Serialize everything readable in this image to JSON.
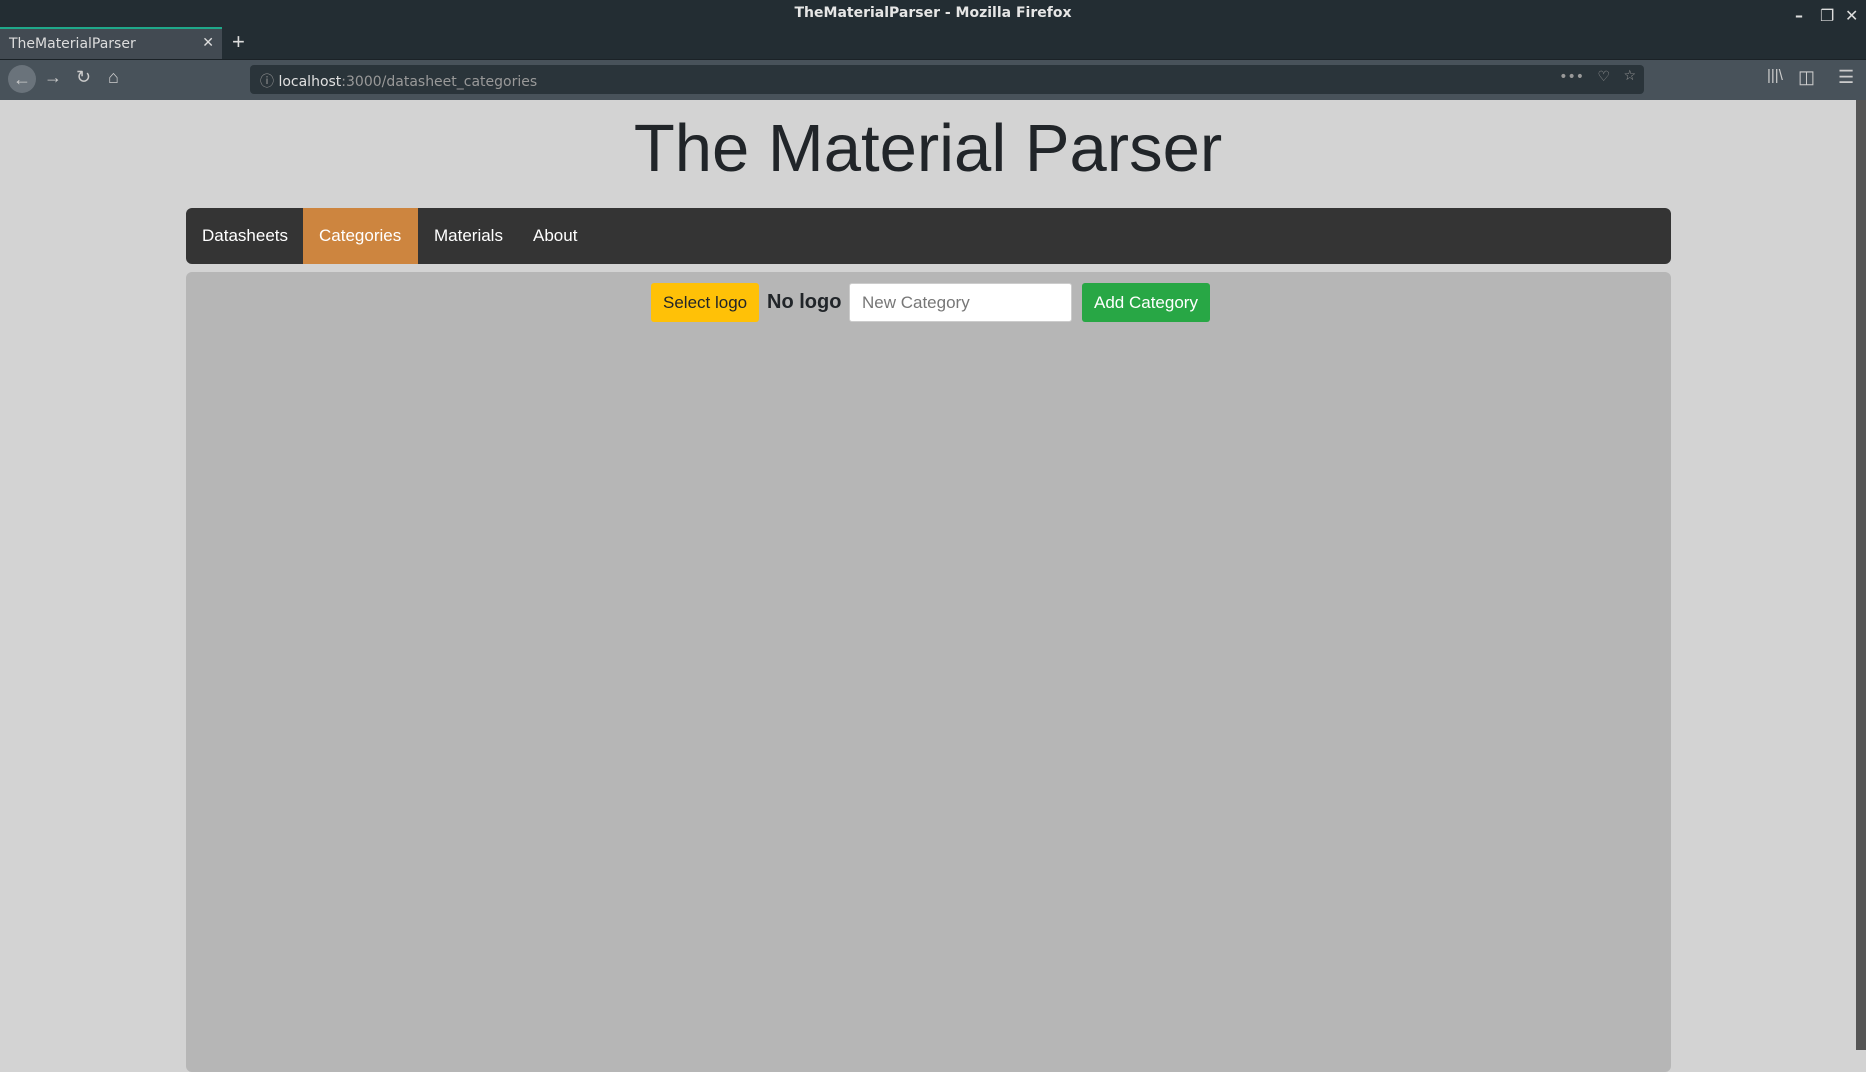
{
  "window": {
    "title": "TheMaterialParser - Mozilla Firefox"
  },
  "browser": {
    "tab_title": "TheMaterialParser",
    "url_host": "localhost",
    "url_path": ":3000/datasheet_categories"
  },
  "page": {
    "heading": "The Material Parser",
    "nav": [
      {
        "label": "Datasheets"
      },
      {
        "label": "Categories",
        "active": true
      },
      {
        "label": "Materials"
      },
      {
        "label": "About"
      }
    ],
    "toolbar": {
      "select_logo": "Select logo",
      "logo_status": "No logo",
      "category_placeholder": "New Category",
      "category_value": "",
      "add_category": "Add Category"
    }
  },
  "colors": {
    "active_nav": "#cd853f",
    "select_logo": "#ffc107",
    "add_category": "#28a745"
  }
}
